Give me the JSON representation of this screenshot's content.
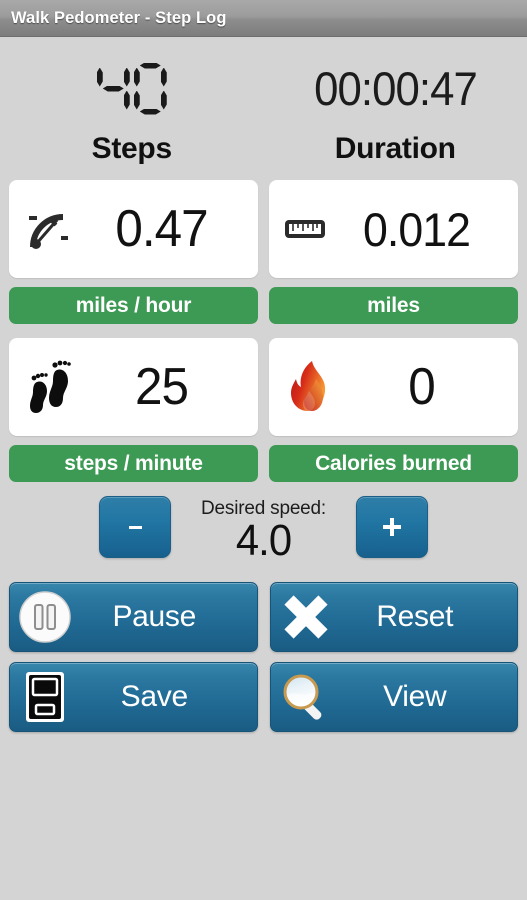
{
  "window": {
    "title": "Walk Pedometer - Step Log"
  },
  "readouts": {
    "steps_lcd": "40",
    "duration_value": "00:00:47",
    "steps_heading": "Steps",
    "duration_heading": "Duration"
  },
  "metrics": [
    {
      "icon": "speedometer-icon",
      "value": "0.47",
      "unit": "miles / hour"
    },
    {
      "icon": "ruler-icon",
      "value": "0.012",
      "unit": "miles"
    },
    {
      "icon": "footprints-icon",
      "value": "25",
      "unit": "steps / minute"
    },
    {
      "icon": "flame-icon",
      "value": "0",
      "unit": "Calories burned"
    }
  ],
  "speed": {
    "label": "Desired speed:",
    "value": "4.0",
    "decrease_label": "-",
    "increase_label": "+"
  },
  "actions": [
    {
      "label": "Pause",
      "icon": "pause-icon"
    },
    {
      "label": "Reset",
      "icon": "close-x-icon"
    },
    {
      "label": "Save",
      "icon": "floppy-disk-icon"
    },
    {
      "label": "View",
      "icon": "magnifier-icon"
    }
  ],
  "colors": {
    "accent_green": "#3d9a54",
    "button_blue": "#2176a3",
    "page_background": "#d4d4d4",
    "card_background": "#ffffff",
    "titlebar_gray": "#9c9c9c"
  }
}
